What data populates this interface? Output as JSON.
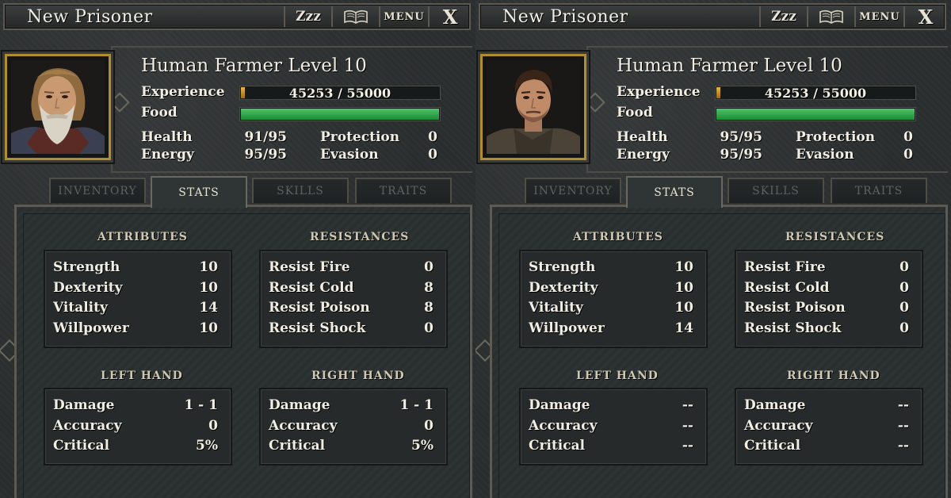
{
  "colors": {
    "frame_gold": "#b08d2e",
    "exp_bar": "#e7b94a",
    "food_bar": "#4ec56a",
    "text": "#f1ede3",
    "tab_inactive": "#5c6263"
  },
  "panels": [
    {
      "title": "New Prisoner",
      "buttons": {
        "sleep": "Zzz",
        "journal_icon": "book-icon",
        "menu": "MENU",
        "close": "X"
      },
      "name_line": "Human Farmer Level 10",
      "experience_label": "Experience",
      "experience_value": "45253 / 55000",
      "experience_fraction": 0.02,
      "food_label": "Food",
      "food_fraction": 1.0,
      "health_label": "Health",
      "health_value": "91/95",
      "energy_label": "Energy",
      "energy_value": "95/95",
      "protection_label": "Protection",
      "protection_value": "0",
      "evasion_label": "Evasion",
      "evasion_value": "0",
      "tabs": [
        "INVENTORY",
        "STATS",
        "SKILLS",
        "TRAITS"
      ],
      "active_tab": "STATS",
      "attributes_title": "ATTRIBUTES",
      "attributes": [
        {
          "label": "Strength",
          "value": "10"
        },
        {
          "label": "Dexterity",
          "value": "10"
        },
        {
          "label": "Vitality",
          "value": "14"
        },
        {
          "label": "Willpower",
          "value": "10"
        }
      ],
      "resistances_title": "RESISTANCES",
      "resistances": [
        {
          "label": "Resist Fire",
          "value": "0"
        },
        {
          "label": "Resist Cold",
          "value": "8"
        },
        {
          "label": "Resist Poison",
          "value": "8"
        },
        {
          "label": "Resist Shock",
          "value": "0"
        }
      ],
      "left_hand_title": "LEFT HAND",
      "left_hand": [
        {
          "label": "Damage",
          "value": "1 - 1"
        },
        {
          "label": "Accuracy",
          "value": "0"
        },
        {
          "label": "Critical",
          "value": "5%"
        }
      ],
      "right_hand_title": "RIGHT HAND",
      "right_hand": [
        {
          "label": "Damage",
          "value": "1 - 1"
        },
        {
          "label": "Accuracy",
          "value": "0"
        },
        {
          "label": "Critical",
          "value": "5%"
        }
      ]
    },
    {
      "title": "New Prisoner",
      "buttons": {
        "sleep": "Zzz",
        "journal_icon": "book-icon",
        "menu": "MENU",
        "close": "X"
      },
      "name_line": "Human Farmer Level 10",
      "experience_label": "Experience",
      "experience_value": "45253 / 55000",
      "experience_fraction": 0.02,
      "food_label": "Food",
      "food_fraction": 1.0,
      "health_label": "Health",
      "health_value": "95/95",
      "energy_label": "Energy",
      "energy_value": "95/95",
      "protection_label": "Protection",
      "protection_value": "0",
      "evasion_label": "Evasion",
      "evasion_value": "0",
      "tabs": [
        "INVENTORY",
        "STATS",
        "SKILLS",
        "TRAITS"
      ],
      "active_tab": "STATS",
      "attributes_title": "ATTRIBUTES",
      "attributes": [
        {
          "label": "Strength",
          "value": "10"
        },
        {
          "label": "Dexterity",
          "value": "10"
        },
        {
          "label": "Vitality",
          "value": "10"
        },
        {
          "label": "Willpower",
          "value": "14"
        }
      ],
      "resistances_title": "RESISTANCES",
      "resistances": [
        {
          "label": "Resist Fire",
          "value": "0"
        },
        {
          "label": "Resist Cold",
          "value": "0"
        },
        {
          "label": "Resist Poison",
          "value": "0"
        },
        {
          "label": "Resist Shock",
          "value": "0"
        }
      ],
      "left_hand_title": "LEFT HAND",
      "left_hand": [
        {
          "label": "Damage",
          "value": "--"
        },
        {
          "label": "Accuracy",
          "value": "--"
        },
        {
          "label": "Critical",
          "value": "--"
        }
      ],
      "right_hand_title": "RIGHT HAND",
      "right_hand": [
        {
          "label": "Damage",
          "value": "--"
        },
        {
          "label": "Accuracy",
          "value": "--"
        },
        {
          "label": "Critical",
          "value": "--"
        }
      ]
    }
  ]
}
